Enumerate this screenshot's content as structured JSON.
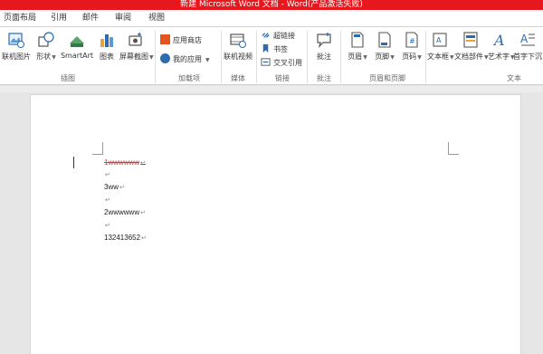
{
  "window": {
    "title": "新建 Microsoft Word 文档 - Word(产品激活失败)"
  },
  "tabs": [
    "页面布局",
    "引用",
    "邮件",
    "审阅",
    "视图"
  ],
  "ribbon": {
    "illustrations": {
      "online_picture": "联机图片",
      "shapes": "形状",
      "smartart": "SmartArt",
      "chart": "图表",
      "screenshot": "屏幕截图",
      "label": "插图"
    },
    "addins": {
      "store": "应用商店",
      "my_apps": "我的应用",
      "label": "加载项"
    },
    "media": {
      "online_video": "联机视频",
      "label": "媒体"
    },
    "links": {
      "hyperlink": "超链接",
      "bookmark": "书签",
      "cross_reference": "交叉引用",
      "label": "链接"
    },
    "comments": {
      "comment": "批注",
      "label": "批注"
    },
    "header_footer": {
      "header": "页眉",
      "footer": "页脚",
      "page_number": "页码",
      "label": "页眉和页脚"
    },
    "text": {
      "textbox": "文本框",
      "quick_parts": "文档部件",
      "wordart": "艺术字",
      "dropcap": "首字下沉",
      "label": "文本"
    }
  },
  "document": {
    "lines": [
      "1wwwwww",
      "",
      "3ww",
      "",
      "2wwwwww",
      "",
      "132413652"
    ],
    "paragraph_mark": "↵"
  },
  "colors": {
    "titlebar": "#e8171e",
    "deleted_text": "#d23b3b"
  }
}
